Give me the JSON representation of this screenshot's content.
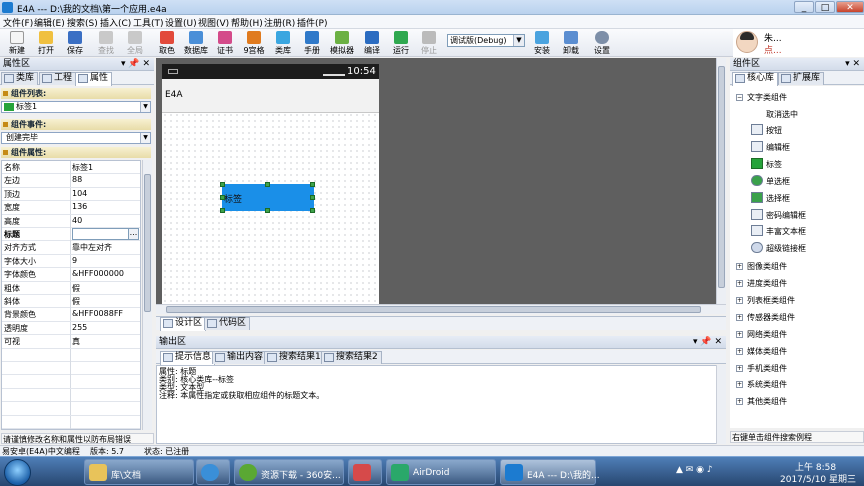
{
  "window": {
    "title": "E4A --- D:\\我的文档\\第一个应用.e4a",
    "min": "_",
    "max": "□",
    "close": "✕"
  },
  "menu": [
    "文件(F)",
    "编辑(E)",
    "搜索(S)",
    "插入(C)",
    "工具(T)",
    "设置(U)",
    "视图(V)",
    "帮助(H)",
    "注册(R)",
    "插件(P)"
  ],
  "toolbar": {
    "items": [
      {
        "label": "新建",
        "color": "#f5f5f5"
      },
      {
        "label": "打开",
        "color": "#f0c040"
      },
      {
        "label": "保存",
        "color": "#3a6fc4"
      },
      {
        "label": "查找",
        "color": "#c9c9c9"
      },
      {
        "label": "全局",
        "color": "#c9c9c9"
      },
      {
        "label": "取色",
        "color": "#e24a3b"
      },
      {
        "label": "数据库",
        "color": "#4a8fd8"
      },
      {
        "label": "证书",
        "color": "#d44b8a"
      },
      {
        "label": "9宫格",
        "color": "#e07b1f"
      },
      {
        "label": "类库",
        "color": "#3aa6e0"
      },
      {
        "label": "手册",
        "color": "#2f79c9"
      },
      {
        "label": "模拟器",
        "color": "#6bb043"
      },
      {
        "label": "编译",
        "color": "#2b6cc1"
      },
      {
        "label": "运行",
        "color": "#2fa84f"
      },
      {
        "label": "停止",
        "color": "#bbbbbb"
      },
      {
        "label": "安装",
        "color": "#4aa3df"
      },
      {
        "label": "卸载",
        "color": "#5b8ed1"
      },
      {
        "label": "设置",
        "color": "#7d8fa8"
      }
    ],
    "mode": "调试版(Debug)"
  },
  "user": {
    "name": "朱...",
    "level": "点..."
  },
  "left_panel": {
    "title": "属性区",
    "pin": "▾ 📌 ✕",
    "tabs": [
      "类库",
      "工程",
      "属性"
    ],
    "component_list_label": "组件列表:",
    "component_selected": "标签1",
    "event_label": "组件事件:",
    "event_selected": "创建完毕",
    "props_label": "组件属性:",
    "properties": [
      {
        "name": "名称",
        "value": "标签1"
      },
      {
        "name": "左边",
        "value": "88"
      },
      {
        "name": "顶边",
        "value": "104"
      },
      {
        "name": "宽度",
        "value": "136"
      },
      {
        "name": "高度",
        "value": "40"
      },
      {
        "name": "标题",
        "value": "",
        "extra": "..."
      },
      {
        "name": "对齐方式",
        "value": "靠中左对齐"
      },
      {
        "name": "字体大小",
        "value": "9"
      },
      {
        "name": "字体颜色",
        "value": "&HFF000000"
      },
      {
        "name": "粗体",
        "value": "假"
      },
      {
        "name": "斜体",
        "value": "假"
      },
      {
        "name": "背景颜色",
        "value": "&HFF0088FF"
      },
      {
        "name": "透明度",
        "value": "255"
      },
      {
        "name": "可视",
        "value": "真"
      }
    ],
    "hint": "请谨慎修改名称和属性以防布局错误"
  },
  "designer": {
    "status_time": "10:54",
    "app_title": "E4A",
    "widget_label": "标签",
    "tabs": [
      "设计区",
      "代码区"
    ]
  },
  "output": {
    "title": "输出区",
    "controls": "▾ 📌 ✕",
    "tabs": [
      "提示信息",
      "输出内容",
      "搜索结果1",
      "搜索结果2"
    ],
    "lines": [
      "属性: 标题",
      "类别: 核心类库--标签",
      "类型: 文本型",
      "注释: 本属性指定或获取相应组件的标题文本。"
    ]
  },
  "right_panel": {
    "title": "组件区",
    "controls": "▾ ✕",
    "tabs": [
      "核心库",
      "扩展库"
    ],
    "categories_top": [
      {
        "label": "文字类组件",
        "expanded": "−"
      }
    ],
    "subitems": [
      "取消选中",
      "按钮",
      "编辑框",
      "标签",
      "单选框",
      "选择框",
      "密码编辑框",
      "丰富文本框",
      "超级链接框"
    ],
    "categories": [
      "图像类组件",
      "进度类组件",
      "列表框类组件",
      "传感器类组件",
      "网络类组件",
      "媒体类组件",
      "手机类组件",
      "系统类组件",
      "其他类组件"
    ],
    "expand_symbol": "+",
    "hint": "右键单击组件搜索例程"
  },
  "statusbar": {
    "app": "易安卓(E4A)中文编程",
    "version": "版本: 5.7",
    "state": "状态: 已注册"
  },
  "taskbar": {
    "items": [
      {
        "label": "库\\文档",
        "color": "#e8c35a"
      },
      {
        "label": "",
        "color": "#3a8fd8"
      },
      {
        "label": "资源下载 - 360安...",
        "color": "#5aa833"
      },
      {
        "label": "",
        "color": "#d64a4a"
      },
      {
        "label": "AirDroid",
        "color": "#2aa86a"
      },
      {
        "label": "E4A --- D:\\我的...",
        "color": "#1c7bd0"
      }
    ],
    "time": "上午 8:58",
    "date": "2017/5/10 星期三"
  }
}
